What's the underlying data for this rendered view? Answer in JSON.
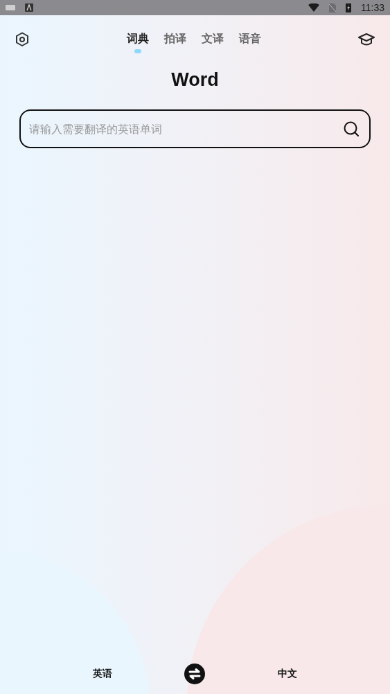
{
  "status_bar": {
    "time": "11:33"
  },
  "tabs": [
    {
      "label": "词典",
      "selected": true
    },
    {
      "label": "拍译",
      "selected": false
    },
    {
      "label": "文译",
      "selected": false
    },
    {
      "label": "语音",
      "selected": false
    }
  ],
  "title": "Word",
  "search": {
    "placeholder": "请输入需要翻译的英语单词"
  },
  "languages": {
    "source": "英语",
    "target": "中文"
  }
}
